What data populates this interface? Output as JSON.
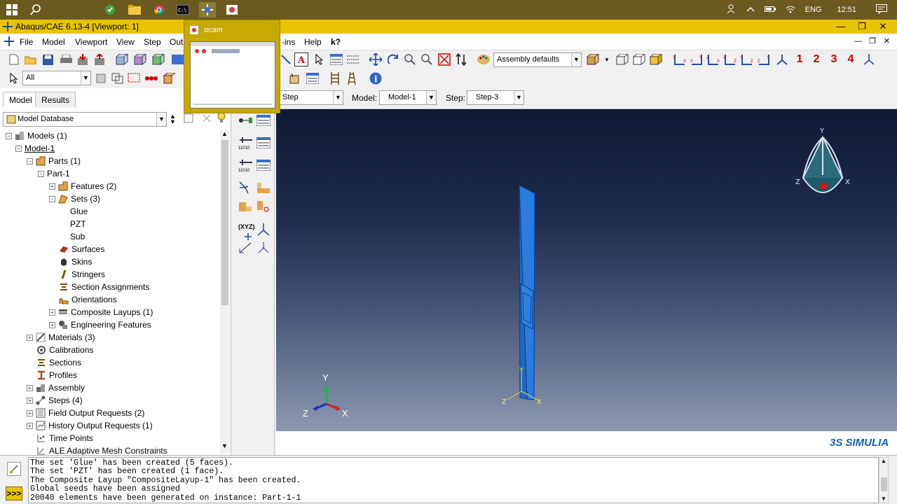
{
  "taskbar": {
    "time": "12:51",
    "language": "ENG"
  },
  "window": {
    "title": "Abaqus/CAE 6.13-4 [Viewport: 1]"
  },
  "menu": [
    "File",
    "Model",
    "Viewport",
    "View",
    "Step",
    "Out",
    "-ins",
    "Help",
    "k?"
  ],
  "toolbar": {
    "render_style": "Assembly defaults",
    "selection_filter": "All",
    "csys_numbers": [
      "1",
      "2",
      "3",
      "4"
    ]
  },
  "context": {
    "module_value": "Step",
    "model_label": "Model:",
    "model_value": "Model-1",
    "step_label": "Step:",
    "step_value": "Step-3"
  },
  "left_panel": {
    "tabs": [
      "Model",
      "Results"
    ],
    "database": "Model Database",
    "tree": [
      {
        "label": "Models (1)"
      },
      {
        "label": "Model-1"
      },
      {
        "label": "Parts (1)"
      },
      {
        "label": "Part-1"
      },
      {
        "label": "Features (2)"
      },
      {
        "label": "Sets (3)"
      },
      {
        "label": "Glue"
      },
      {
        "label": "PZT"
      },
      {
        "label": "Sub"
      },
      {
        "label": "Surfaces"
      },
      {
        "label": "Skins"
      },
      {
        "label": "Stringers"
      },
      {
        "label": "Section Assignments"
      },
      {
        "label": "Orientations"
      },
      {
        "label": "Composite Layups (1)"
      },
      {
        "label": "Engineering Features"
      },
      {
        "label": "Materials (3)"
      },
      {
        "label": "Calibrations"
      },
      {
        "label": "Sections"
      },
      {
        "label": "Profiles"
      },
      {
        "label": "Assembly"
      },
      {
        "label": "Steps (4)"
      },
      {
        "label": "Field Output Requests (2)"
      },
      {
        "label": "History Output Requests (1)"
      },
      {
        "label": "Time Points"
      },
      {
        "label": "ALE Adaptive Mesh Constraints"
      }
    ]
  },
  "toolbox": {
    "xyz_label": "(XYZ)"
  },
  "viewport": {
    "triad_labels": {
      "y": "Y",
      "x": "X",
      "z": "Z"
    },
    "brand": "3S SIMULIA"
  },
  "popup": {
    "title": "ocam"
  },
  "messages": [
    "The set 'Glue' has been created (5 faces).",
    "The set 'PZT' has been created (1 face).",
    "The Composite Layup \"CompositeLayup-1\" has been created.",
    "Global seeds have been assigned",
    "20040 elements have been generated on instance: Part-1-1"
  ],
  "colors": {
    "taskbar": "#6b5a1e",
    "titlebar": "#e7c300",
    "part_blue": "#2a7be0",
    "viewport_top": "#0f1a33",
    "viewport_bottom": "#8c98ae"
  }
}
